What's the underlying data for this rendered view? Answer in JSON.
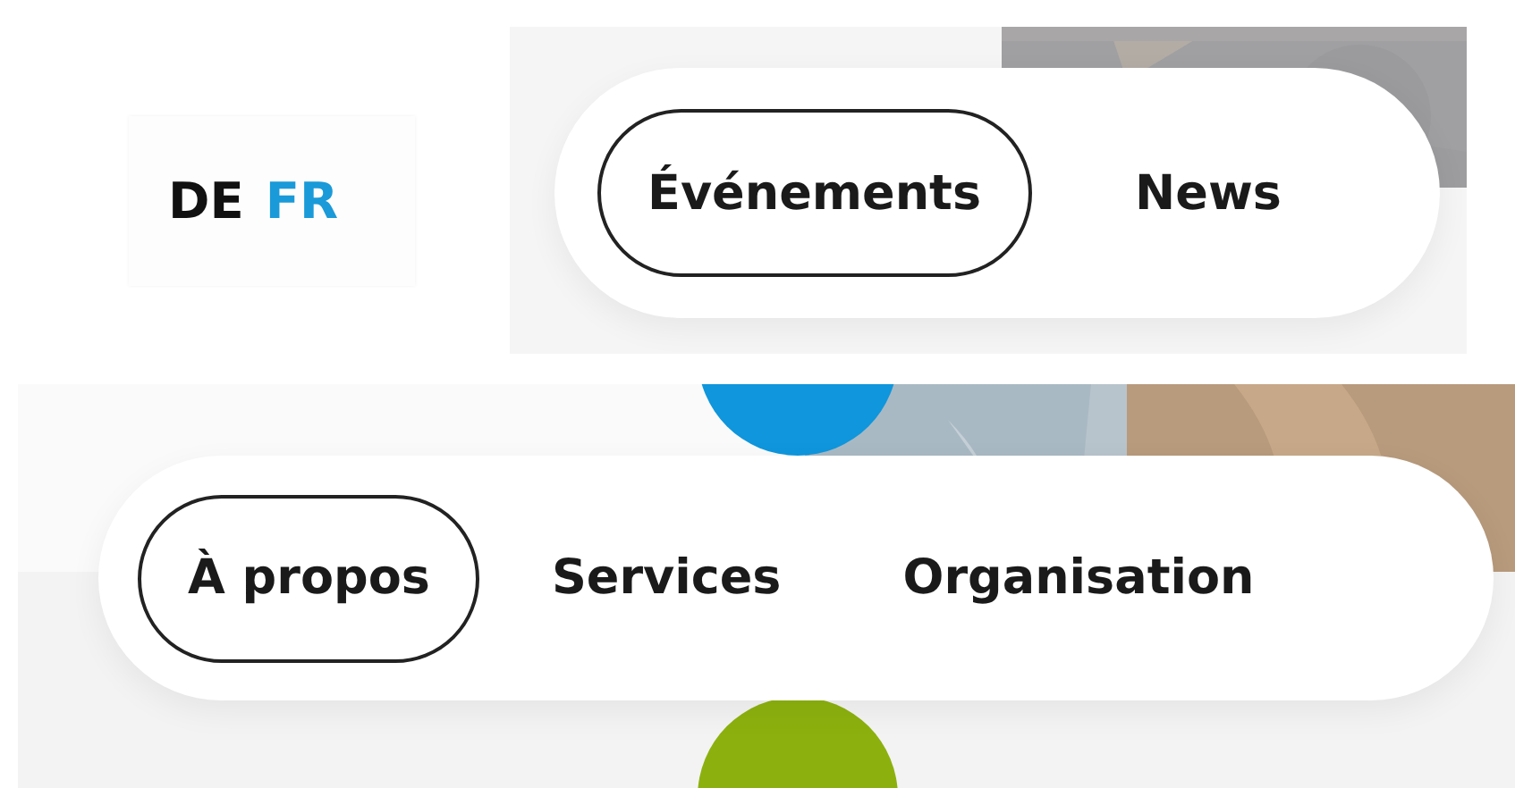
{
  "languages": [
    {
      "label": "DE",
      "selected": false
    },
    {
      "label": "FR",
      "selected": true
    }
  ],
  "top_tabs": [
    {
      "label": "Événements",
      "selected": true
    },
    {
      "label": "News",
      "selected": false
    }
  ],
  "main_tabs": [
    {
      "label": "À propos",
      "selected": true
    },
    {
      "label": "Services",
      "selected": false
    },
    {
      "label": "Organisation",
      "selected": false
    }
  ]
}
